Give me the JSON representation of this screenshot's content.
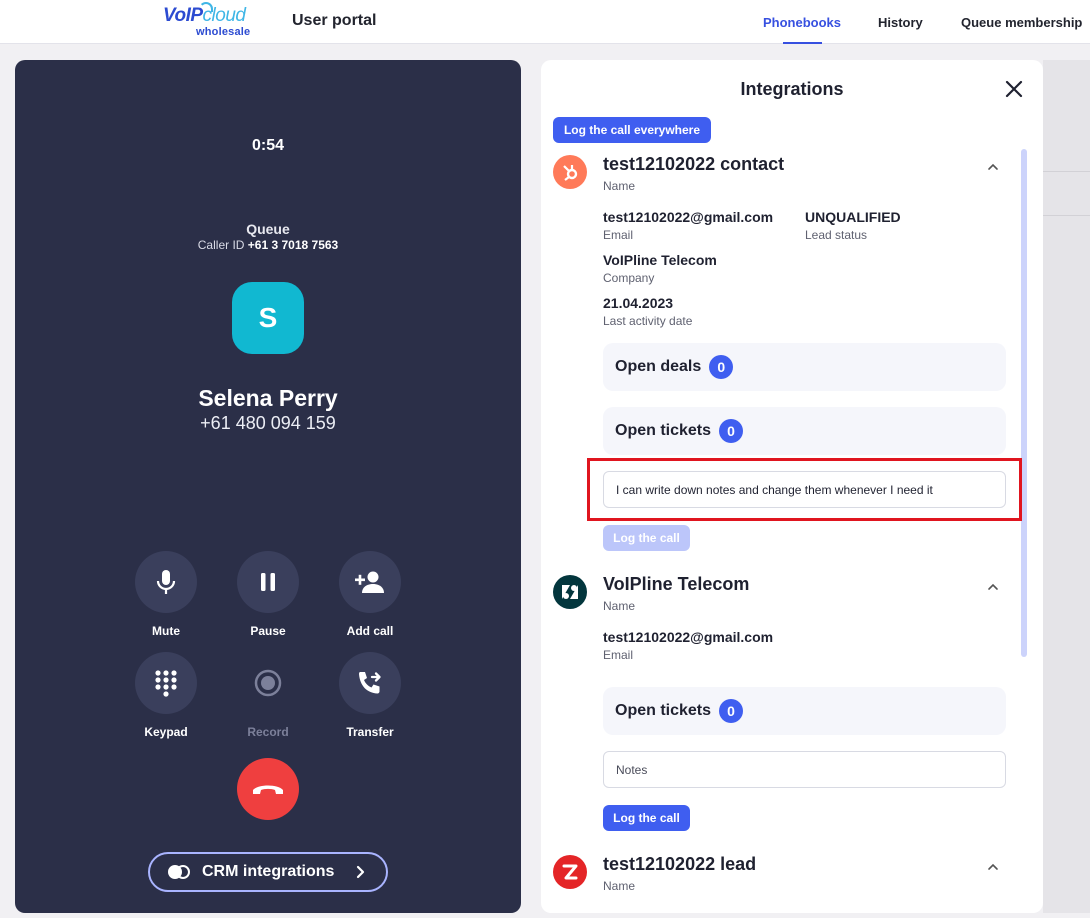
{
  "header": {
    "logo_main_a": "VoIP",
    "logo_main_b": "cloud",
    "logo_sub": "wholesale",
    "title": "User portal",
    "nav": [
      "Phonebooks",
      "History",
      "Queue membership"
    ],
    "active_nav": "Phonebooks"
  },
  "call": {
    "timer": "0:54",
    "queue": "Queue",
    "caller_id_label": "Caller ID",
    "caller_id_number": "+61 3 7018 7563",
    "avatar_letter": "S",
    "name": "Selena Perry",
    "phone": "+61 480 094 159",
    "controls": {
      "mute": "Mute",
      "pause": "Pause",
      "add_call": "Add call",
      "keypad": "Keypad",
      "record": "Record",
      "transfer": "Transfer"
    },
    "crm_button": "CRM integrations",
    "accent_color": "#11b8d1",
    "hangup_color": "#ef3f3f"
  },
  "integrations": {
    "title": "Integrations",
    "log_everywhere": "Log the call everywhere",
    "hubspot": {
      "icon": "hubspot-icon",
      "title": "test12102022 contact",
      "title_label": "Name",
      "email": "test12102022@gmail.com",
      "email_label": "Email",
      "lead_status": "UNQUALIFIED",
      "lead_status_label": "Lead status",
      "company": "VoIPline Telecom",
      "company_label": "Company",
      "last_activity": "21.04.2023",
      "last_activity_label": "Last activity date",
      "open_deals_label": "Open deals",
      "open_deals_count": "0",
      "open_tickets_label": "Open tickets",
      "open_tickets_count": "0",
      "notes_value": "I can write down notes and change them whenever I need it",
      "log_button": "Log the call"
    },
    "zendesk": {
      "icon": "zendesk-icon",
      "title": "VoIPline Telecom",
      "title_label": "Name",
      "email": "test12102022@gmail.com",
      "email_label": "Email",
      "open_tickets_label": "Open tickets",
      "open_tickets_count": "0",
      "notes_placeholder": "Notes",
      "log_button": "Log the call"
    },
    "zoho": {
      "icon": "zoho-icon",
      "title": "test12102022 lead",
      "title_label": "Name"
    }
  }
}
